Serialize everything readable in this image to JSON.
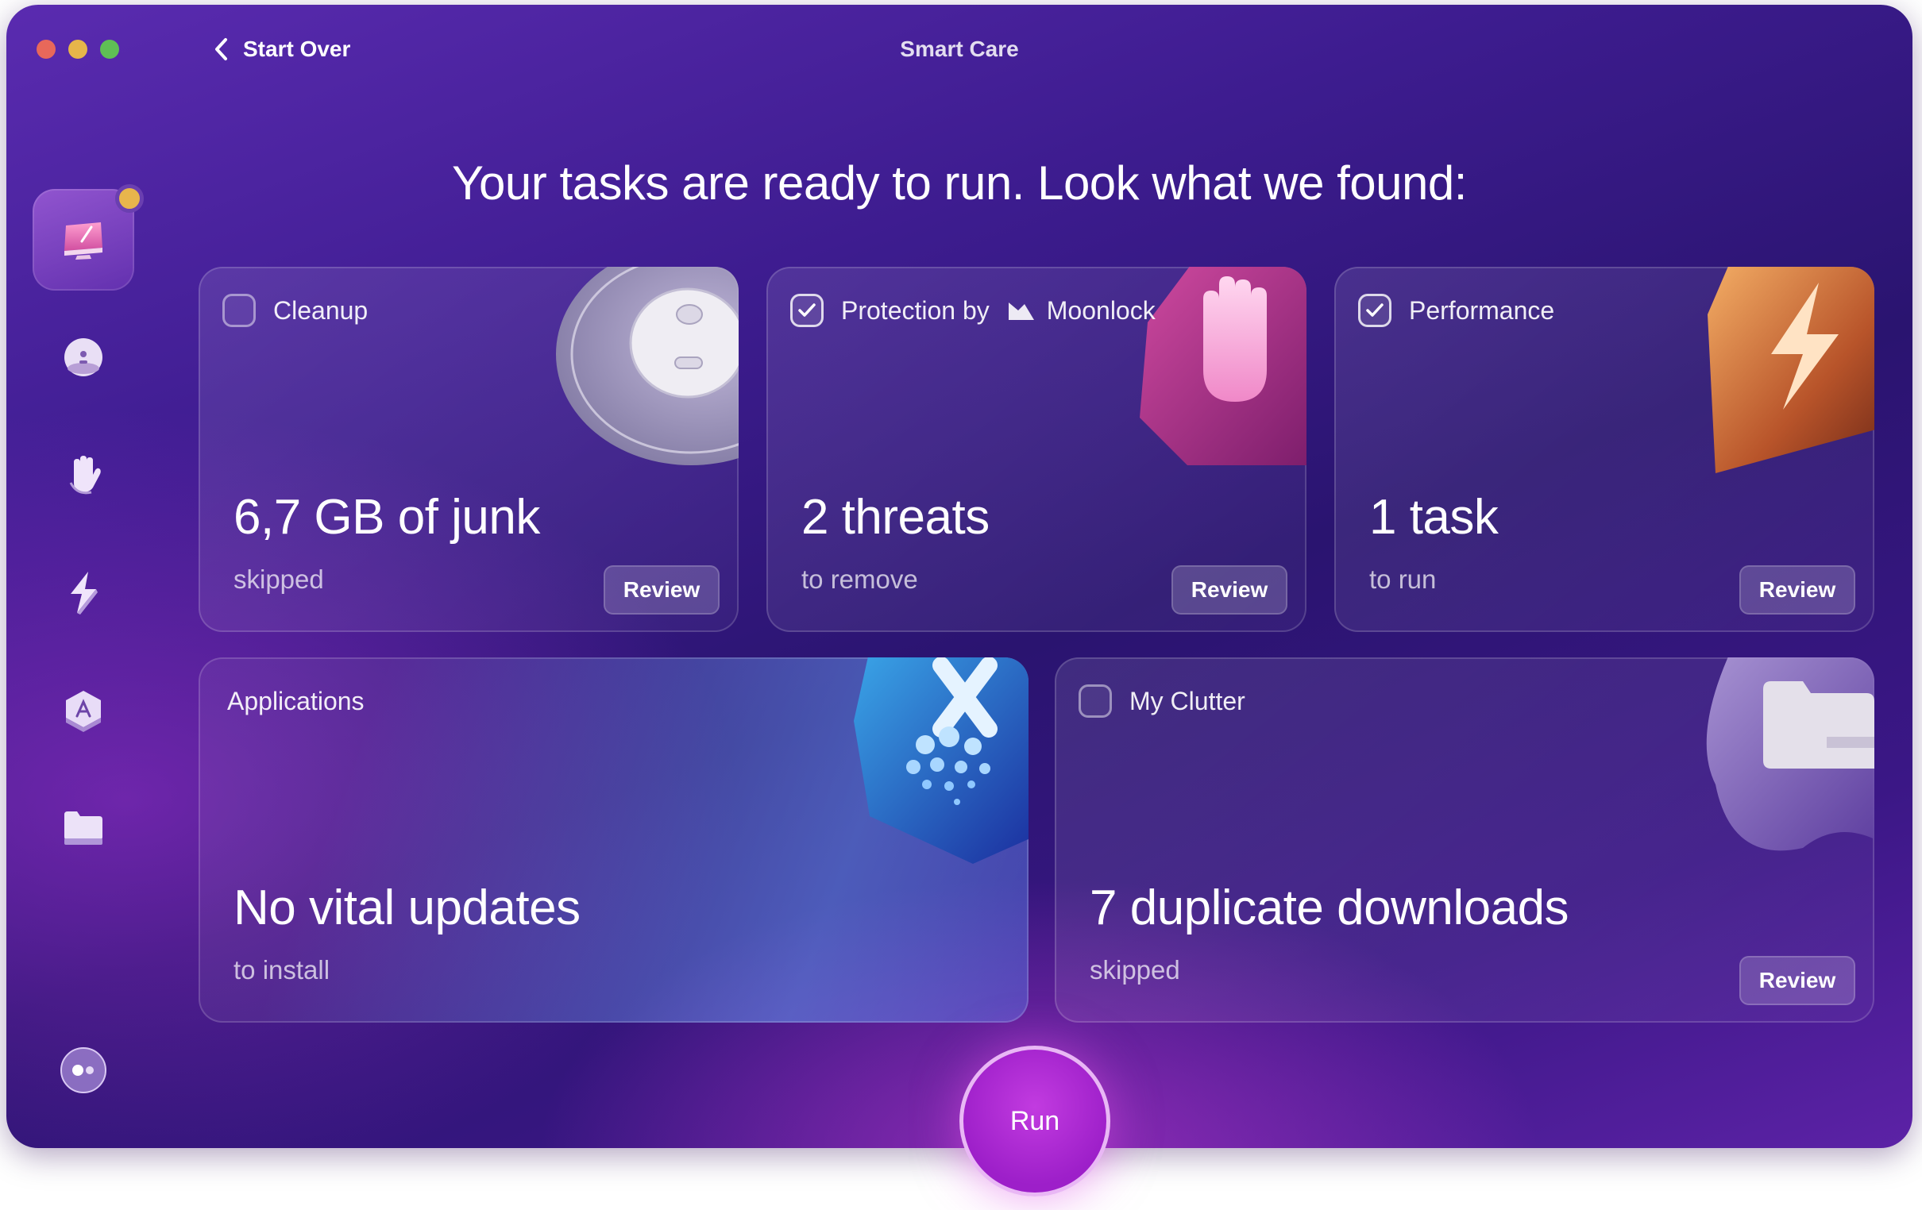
{
  "window": {
    "title": "Smart Care",
    "back_label": "Start Over"
  },
  "sidebar": {
    "items": [
      {
        "name": "smart-care",
        "icon": "display-icon",
        "active": true
      },
      {
        "name": "cleanup",
        "icon": "disc-icon"
      },
      {
        "name": "protection",
        "icon": "hand-icon"
      },
      {
        "name": "performance",
        "icon": "lightning-icon"
      },
      {
        "name": "applications",
        "icon": "apps-icon"
      },
      {
        "name": "my-clutter",
        "icon": "folder-icon"
      }
    ],
    "bottom_icon": "assistant-icon"
  },
  "heading": "Your tasks are ready to run. Look what we found:",
  "cards": {
    "cleanup": {
      "title": "Cleanup",
      "checked": false,
      "value": "6,7 GB of junk",
      "subtitle": "skipped",
      "button": "Review"
    },
    "protection": {
      "title": "Protection by",
      "brand": "Moonlock",
      "checked": true,
      "value": "2 threats",
      "subtitle": "to remove",
      "button": "Review"
    },
    "performance": {
      "title": "Performance",
      "checked": true,
      "value": "1 task",
      "subtitle": "to run",
      "button": "Review"
    },
    "applications": {
      "title": "Applications",
      "value": "No vital updates",
      "subtitle": "to install"
    },
    "clutter": {
      "title": "My Clutter",
      "checked": false,
      "value": "7 duplicate downloads",
      "subtitle": "skipped",
      "button": "Review"
    }
  },
  "run_button": "Run",
  "colors": {
    "accent": "#b02fd8",
    "background_dark": "#2a1470",
    "background_light": "#5a2bb0"
  }
}
